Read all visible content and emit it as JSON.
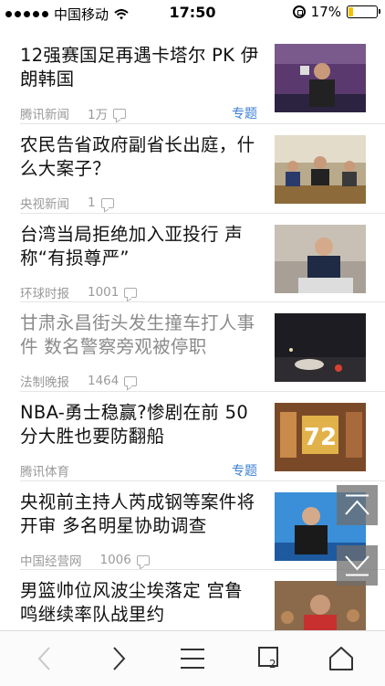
{
  "status_bar": {
    "carrier": "中国移动",
    "time": "17:50",
    "battery_percent": "17%",
    "battery_level": 0.17
  },
  "news": [
    {
      "title": "12强赛国足再遇卡塔尔 PK 伊朗韩国",
      "source": "腾讯新闻",
      "count": "1万",
      "tag": "专题",
      "read": false,
      "thumbnail": "football-draw-photo"
    },
    {
      "title": "农民告省政府副省长出庭，什么大案子？",
      "source": "央视新闻",
      "count": "1",
      "tag": "",
      "read": false,
      "thumbnail": "court-hearing-photo"
    },
    {
      "title": "台湾当局拒绝加入亚投行 声称“有损尊严”",
      "source": "环球时报",
      "count": "1001",
      "tag": "",
      "read": false,
      "thumbnail": "official-speaking-photo"
    },
    {
      "title": "甘肃永昌街头发生撞车打人事件 数名警察旁观被停职",
      "source": "法制晚报",
      "count": "1464",
      "tag": "",
      "read": true,
      "thumbnail": "night-street-photo"
    },
    {
      "title": "NBA-勇士稳赢?惨剧在前 50分大胜也要防翻船",
      "source": "腾讯体育",
      "count": "",
      "tag": "专题",
      "read": false,
      "thumbnail": "basketball-72-photo"
    },
    {
      "title": "央视前主持人芮成钢等案件将开审 多名明星协助调查",
      "source": "中国经营网",
      "count": "1006",
      "tag": "",
      "read": false,
      "thumbnail": "tv-host-photo"
    },
    {
      "title": "男篮帅位风波尘埃落定 宫鲁鸣继续率队战里约",
      "source": "",
      "count": "",
      "tag": "",
      "read": false,
      "thumbnail": "basketball-team-photo"
    }
  ],
  "toolbar": {
    "icons": [
      "back-icon",
      "forward-icon",
      "menu-icon",
      "tabs-icon",
      "home-icon"
    ],
    "tab_count": "2"
  },
  "floating": {
    "up": "scroll-top-icon",
    "down": "scroll-down-icon"
  }
}
